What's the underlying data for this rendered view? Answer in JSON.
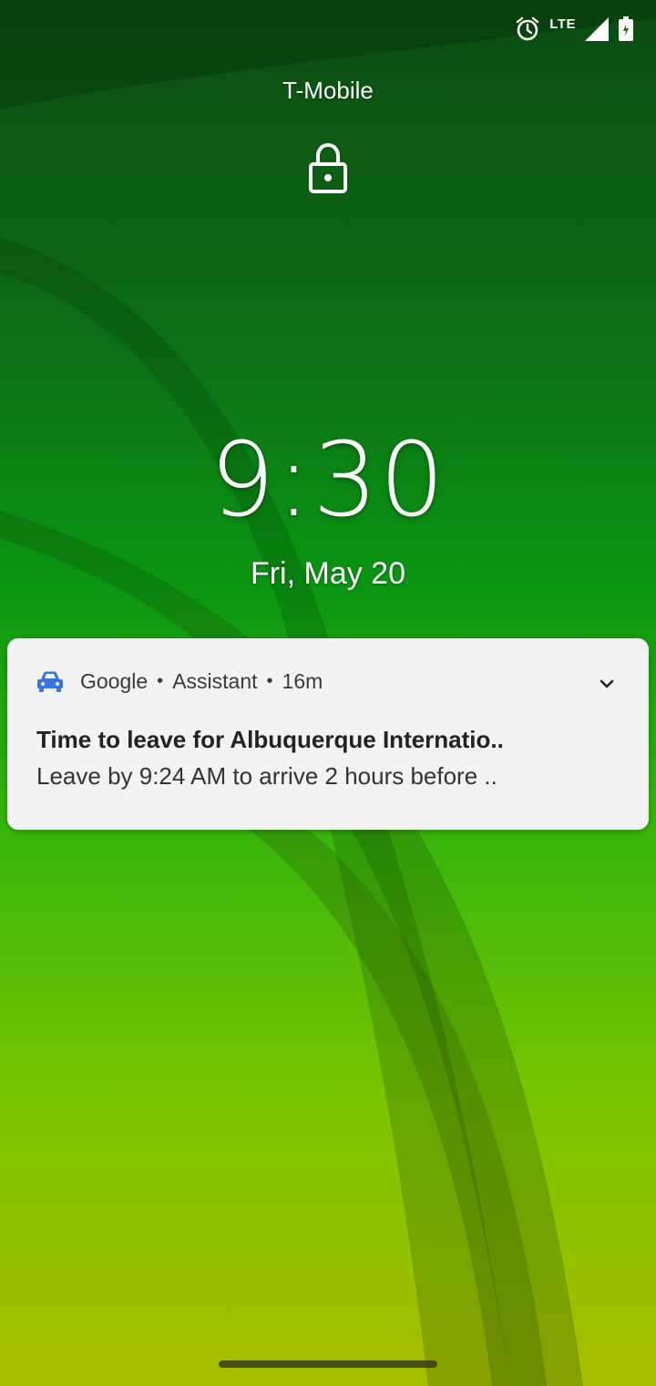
{
  "status_bar": {
    "network_label": "LTE",
    "icons": [
      "alarm-icon",
      "signal-icon",
      "battery-icon"
    ]
  },
  "lock_screen": {
    "carrier": "T-Mobile",
    "time": "9:30",
    "date": "Fri, May 20",
    "lock_icon": "lock-icon"
  },
  "notification": {
    "app_icon": "car-icon",
    "app_name": "Google",
    "sub_app": "Assistant",
    "elapsed": "16m",
    "title": "Time to leave for Albuquerque Internatio..",
    "text": "Leave by 9:24 AM to arrive 2 hours before ..",
    "accent_color": "#3b73e0"
  },
  "colors": {
    "wallpaper_top": "#0b4a12",
    "wallpaper_bottom": "#a8bd00",
    "card_background": "#f3f3f3"
  }
}
